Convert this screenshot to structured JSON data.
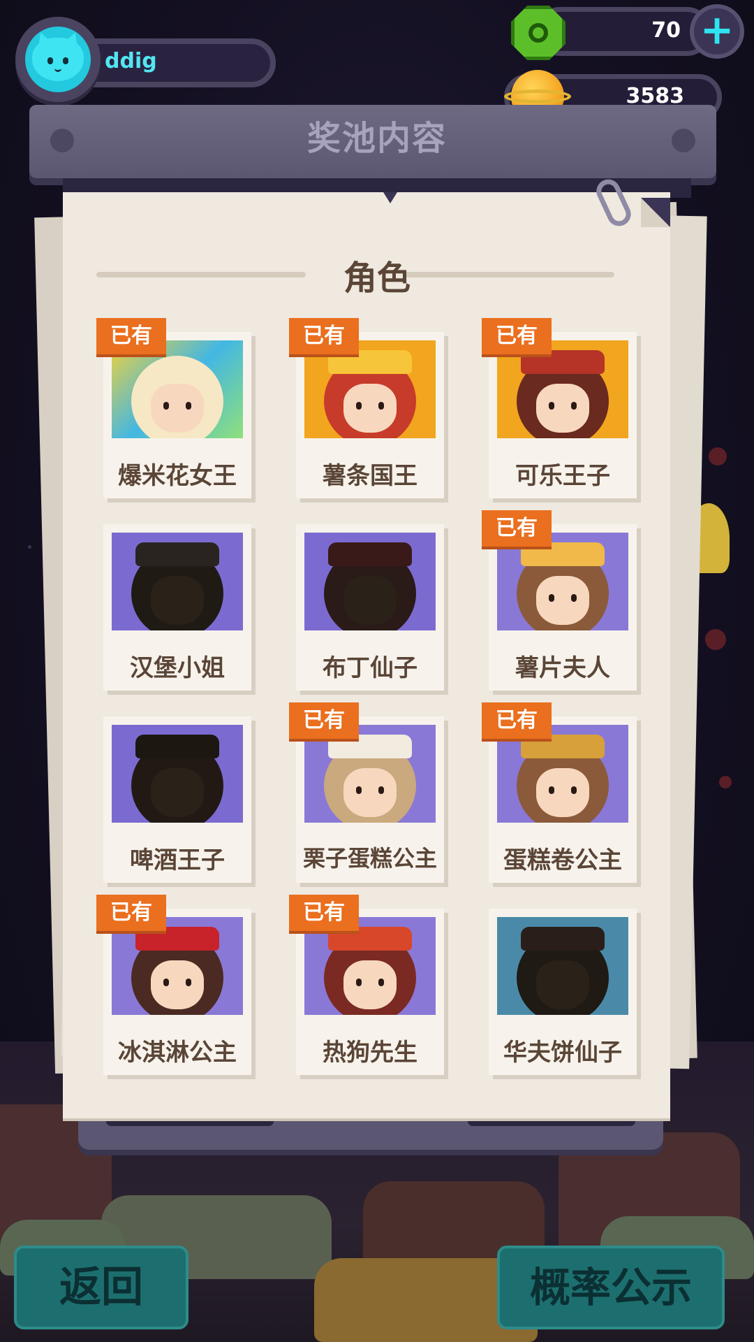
{
  "header": {
    "username": "ddig",
    "currency_gems": "70",
    "currency_coins": "3583",
    "add_button": "+"
  },
  "board": {
    "title": "奖池内容",
    "section_heading": "角色"
  },
  "owned_label": "已有",
  "characters": [
    {
      "name": "爆米花女王",
      "owned": true
    },
    {
      "name": "薯条国王",
      "owned": true
    },
    {
      "name": "可乐王子",
      "owned": true
    },
    {
      "name": "汉堡小姐",
      "owned": false
    },
    {
      "name": "布丁仙子",
      "owned": false
    },
    {
      "name": "薯片夫人",
      "owned": true
    },
    {
      "name": "啤酒王子",
      "owned": false
    },
    {
      "name": "栗子蛋糕公主",
      "owned": true
    },
    {
      "name": "蛋糕卷公主",
      "owned": true
    },
    {
      "name": "冰淇淋公主",
      "owned": true
    },
    {
      "name": "热狗先生",
      "owned": true
    },
    {
      "name": "华夫饼仙子",
      "owned": false
    }
  ],
  "footer": {
    "back_button": "返回",
    "probability_button": "概率公示"
  },
  "colors": {
    "owned_tag": "#ea6f1e",
    "paper": "#efe9e0",
    "accent_cyan": "#2fe3f0",
    "button_teal": "#1d6f6f"
  },
  "icons": {
    "avatar": "cat-avatar-icon",
    "gem": "green-gem-icon",
    "coin": "planet-coin-icon",
    "plus": "plus-icon",
    "clip": "paperclip-icon"
  }
}
